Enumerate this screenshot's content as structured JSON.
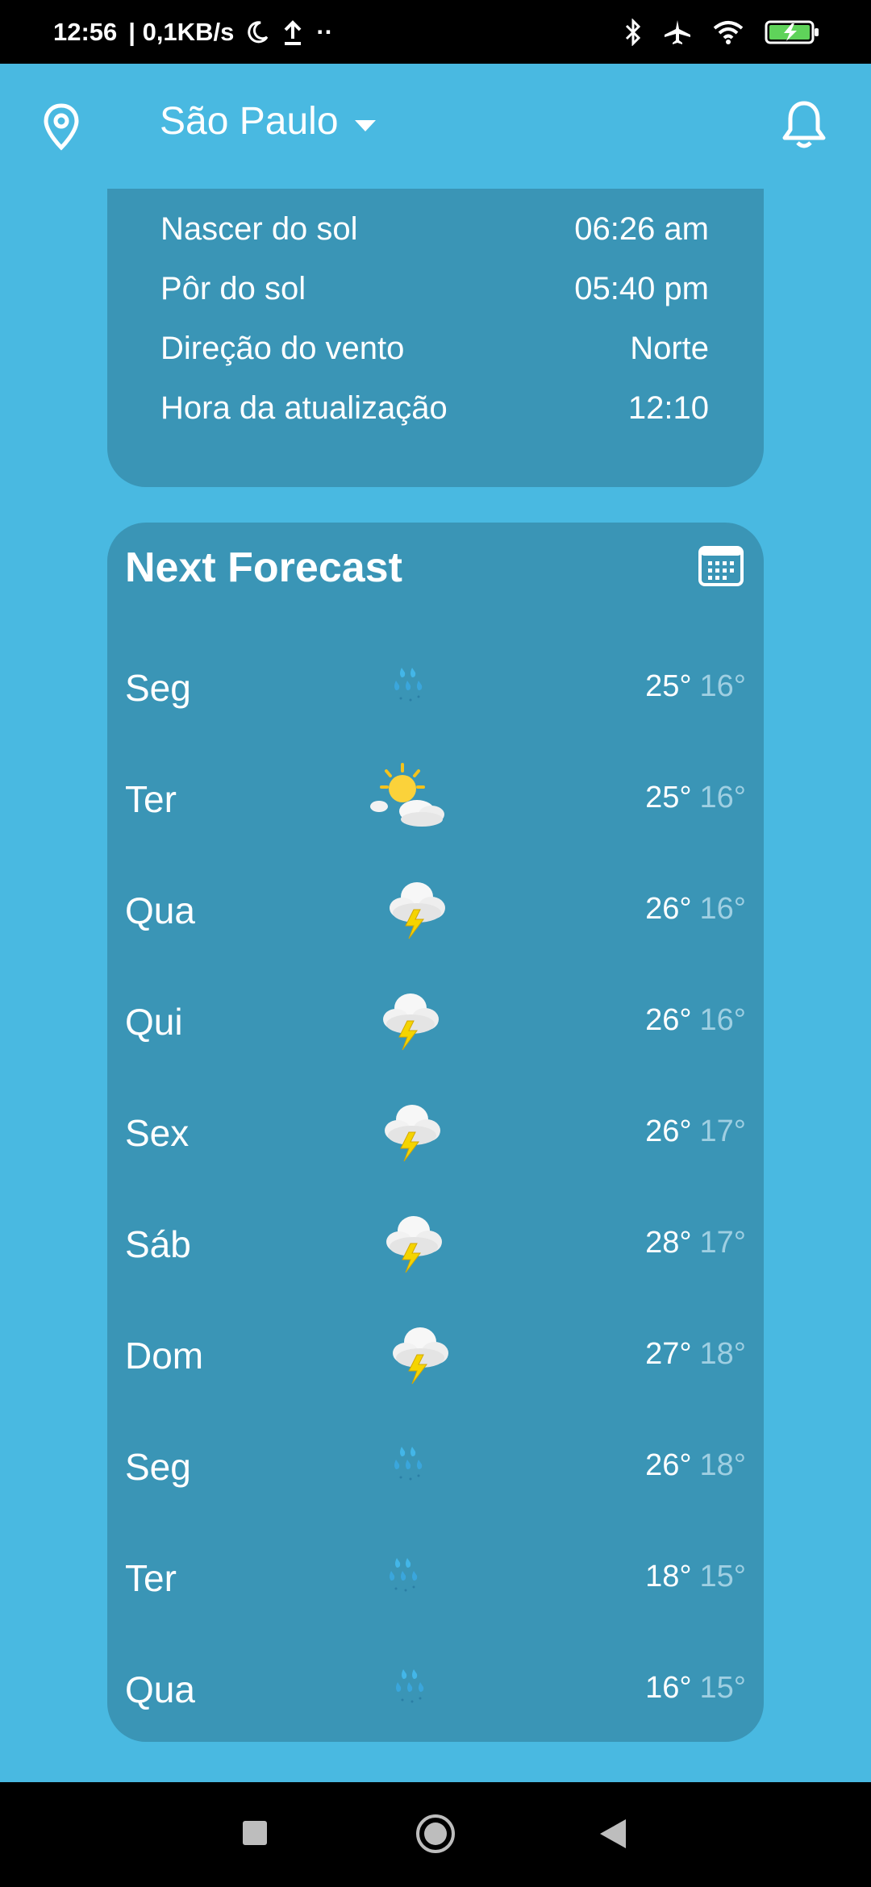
{
  "status_bar": {
    "time": "12:56",
    "net_speed": "| 0,1KB/s",
    "dots": "··"
  },
  "header": {
    "city": "São Paulo"
  },
  "details": [
    {
      "label": "Nascer do sol",
      "value": "06:26 am"
    },
    {
      "label": "Pôr do sol",
      "value": "05:40 pm"
    },
    {
      "label": "Direção do vento",
      "value": "Norte"
    },
    {
      "label": "Hora da atualização",
      "value": "12:10"
    }
  ],
  "forecast": {
    "title": "Next Forecast",
    "days": [
      {
        "day": "Seg",
        "icon": "rain-icon",
        "high": "25°",
        "low": "16°"
      },
      {
        "day": "Ter",
        "icon": "partly-sunny-icon",
        "high": "25°",
        "low": "16°"
      },
      {
        "day": "Qua",
        "icon": "thunderstorm-icon",
        "high": "26°",
        "low": "16°"
      },
      {
        "day": "Qui",
        "icon": "thunderstorm-icon",
        "high": "26°",
        "low": "16°"
      },
      {
        "day": "Sex",
        "icon": "thunderstorm-icon",
        "high": "26°",
        "low": "17°"
      },
      {
        "day": "Sáb",
        "icon": "thunderstorm-icon",
        "high": "28°",
        "low": "17°"
      },
      {
        "day": "Dom",
        "icon": "thunderstorm-icon",
        "high": "27°",
        "low": "18°"
      },
      {
        "day": "Seg",
        "icon": "rain-icon",
        "high": "26°",
        "low": "18°"
      },
      {
        "day": "Ter",
        "icon": "rain-icon",
        "high": "18°",
        "low": "15°"
      },
      {
        "day": "Qua",
        "icon": "rain-icon",
        "high": "16°",
        "low": "15°"
      }
    ]
  },
  "colors": {
    "background": "#49b9e1",
    "card": "#3a95b6",
    "low_temp": "#9fcfe2"
  }
}
